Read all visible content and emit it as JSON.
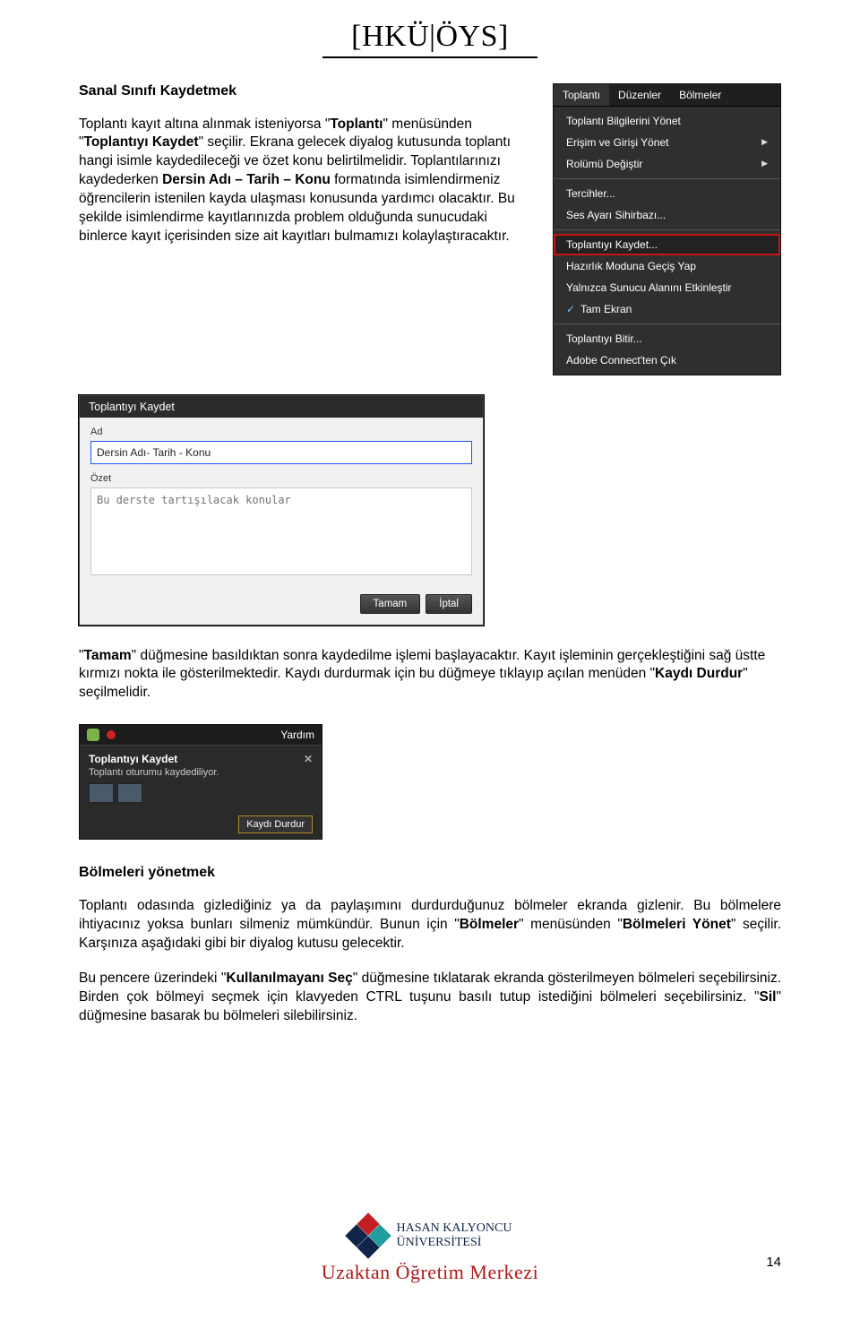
{
  "header": {
    "brand": "[HKÜ|ÖYS]"
  },
  "section1": {
    "title": "Sanal Sınıfı Kaydetmek",
    "para_a1": "Toplantı kayıt altına alınmak isteniyorsa \"",
    "para_a_b1": "Toplantı",
    "para_a2": "\" menüsünden \"",
    "para_a_b2": "Toplantıyı Kaydet",
    "para_a3": "\" seçilir. Ekrana gelecek diyalog kutusunda toplantı hangi isimle kaydedileceği ve özet konu belirtilmelidir. Toplantılarınızı kaydederken ",
    "para_a_b3": "Dersin Adı – Tarih – Konu",
    "para_a4": " formatında isimlendirmeniz öğrencilerin istenilen kayda ulaşması konusunda yardımcı olacaktır. Bu şekilde isimlendirme kayıtlarınızda problem olduğunda sunucudaki binlerce kayıt içerisinden size ait kayıtları bulmamızı kolaylaştıracaktır."
  },
  "menu": {
    "tabs": [
      "Toplantı",
      "Düzenler",
      "Bölmeler"
    ],
    "items_top": [
      {
        "label": "Toplantı Bilgilerini Yönet",
        "arrow": false
      },
      {
        "label": "Erişim ve Girişi Yönet",
        "arrow": true
      },
      {
        "label": "Rolümü Değiştir",
        "arrow": true
      }
    ],
    "items_mid": [
      {
        "label": "Tercihler..."
      },
      {
        "label": "Ses Ayarı Sihirbazı..."
      }
    ],
    "highlight": "Toplantıyı Kaydet...",
    "items_after": [
      {
        "label": "Hazırlık Moduna Geçiş Yap"
      },
      {
        "label": "Yalnızca Sunucu Alanını Etkinleştir"
      },
      {
        "label": "Tam Ekran",
        "check": true
      }
    ],
    "items_bot": [
      {
        "label": "Toplantıyı Bitir..."
      },
      {
        "label": "Adobe Connect'ten Çık"
      }
    ]
  },
  "dialog": {
    "title": "Toplantıyı Kaydet",
    "label_name": "Ad",
    "name_value": "Dersin Adı- Tarih - Konu",
    "label_summary": "Özet",
    "summary_placeholder": "Bu derste tartışılacak konular",
    "ok": "Tamam",
    "cancel": "İptal"
  },
  "para2_a": "\"",
  "para2_b1": "Tamam",
  "para2_b": "\" düğmesine basıldıktan sonra kaydedilme işlemi başlayacaktır. Kayıt işleminin gerçekleştiğini sağ üstte kırmızı nokta ile gösterilmektedir. Kaydı durdurmak için bu düğmeye tıklayıp açılan menüden \"",
  "para2_b2": "Kaydı Durdur",
  "para2_c": "\" seçilmelidir.",
  "toast": {
    "help": "Yardım",
    "title": "Toplantıyı Kaydet",
    "sub": "Toplantı oturumu kaydediliyor.",
    "stop": "Kaydı Durdur"
  },
  "section2": {
    "title": "Bölmeleri yönetmek",
    "p1_a": "Toplantı odasında gizlediğiniz ya da paylaşımını durdurduğunuz bölmeler ekranda gizlenir. Bu bölmelere ihtiyacınız yoksa bunları silmeniz mümkündür. Bunun için \"",
    "p1_b1": "Bölmeler",
    "p1_b": "\" menüsünden \"",
    "p1_b2": "Bölmeleri Yönet",
    "p1_c": "\" seçilir. Karşınıza aşağıdaki gibi bir diyalog kutusu gelecektir.",
    "p2_a": "Bu pencere üzerindeki \"",
    "p2_b1": "Kullanılmayanı Seç",
    "p2_b": "\" düğmesine tıklatarak ekranda gösterilmeyen bölmeleri seçebilirsiniz. Birden çok bölmeyi seçmek için klavyeden CTRL tuşunu basılı tutup istediğini bölmeleri seçebilirsiniz. \"",
    "p2_b2": "Sil",
    "p2_c": "\" düğmesine basarak bu bölmeleri silebilirsiniz."
  },
  "footer": {
    "uni_line1": "HASAN KALYONCU",
    "uni_line2": "ÜNİVERSİTESİ",
    "uzaktan": "Uzaktan Öğretim Merkezi",
    "page": "14"
  }
}
